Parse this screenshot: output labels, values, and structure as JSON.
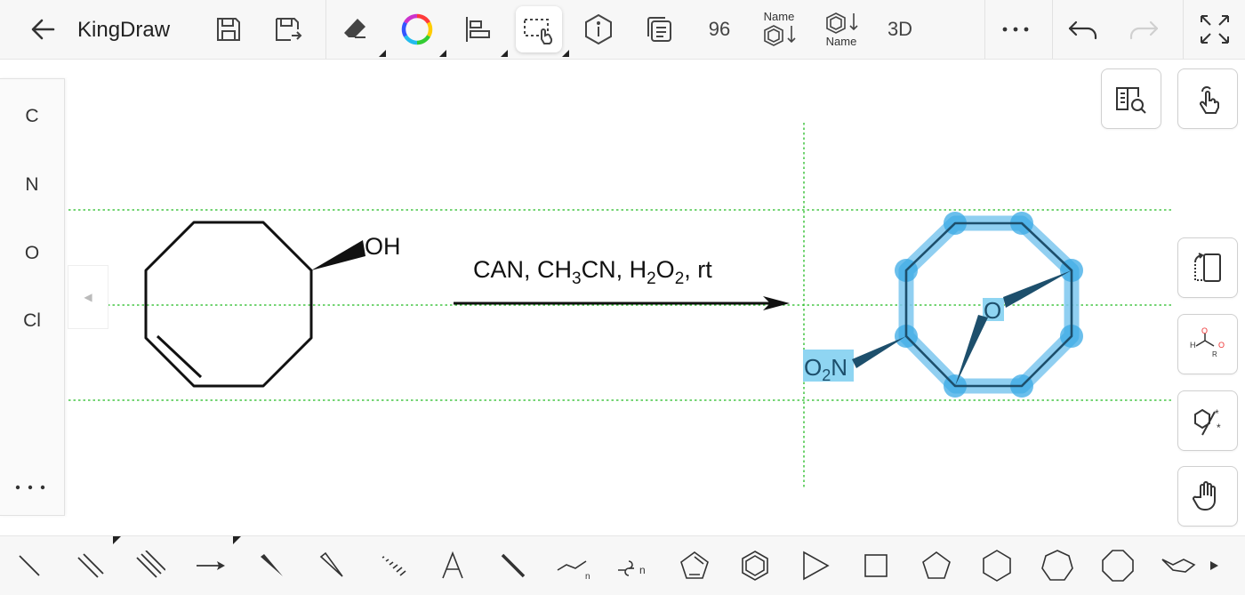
{
  "app": {
    "title": "KingDraw"
  },
  "toolbar": {
    "count_label": "96",
    "name_top_label": "Name",
    "name_bottom_label": "Name",
    "threed_label": "3D"
  },
  "elements_panel": {
    "items": [
      "C",
      "N",
      "O",
      "Cl"
    ]
  },
  "reaction": {
    "reactant_oh": "OH",
    "conditions": {
      "p1": "CAN, CH",
      "s1": "3",
      "p2": "CN, H",
      "s2": "2",
      "p3": "O",
      "s3": "2",
      "p4": ", rt"
    },
    "product_o": "O",
    "product_no2_o": "O",
    "product_no2_sub": "2",
    "product_no2_n": "N"
  },
  "colors": {
    "selection": "#3aaae6",
    "guide_lines": "#22bb22",
    "bond": "#111111",
    "product_bond": "#1d4f6c"
  },
  "icons": {
    "toolbar": [
      "back-arrow-icon",
      "save-icon",
      "save-as-icon",
      "eraser-icon",
      "color-wheel-icon",
      "align-icon",
      "lasso-select-icon",
      "info-icon",
      "copy-pages-icon",
      "name-to-structure-icon",
      "structure-to-name-icon",
      "more-icon",
      "undo-icon",
      "redo-icon",
      "fullscreen-icon"
    ],
    "right_panel": [
      "search-book-icon",
      "touch-draw-icon",
      "rotate-screen-icon",
      "functional-group-icon",
      "chirality-icon",
      "hand-pan-icon"
    ],
    "bottom": [
      "single-bond-icon",
      "double-bond-icon",
      "triple-bond-icon",
      "arrow-icon",
      "wedge-bond-icon",
      "hollow-wedge-icon",
      "hash-bond-icon",
      "text-icon",
      "bold-bond-icon",
      "chain-icon",
      "polymer-bracket-icon",
      "cyclopentadiene-icon",
      "benzene-icon",
      "triangle-icon",
      "square-icon",
      "pentagon-icon",
      "hexagon-icon",
      "heptagon-icon",
      "octagon-icon",
      "cyclohexane-chair-icon",
      "expand-right-icon"
    ]
  }
}
